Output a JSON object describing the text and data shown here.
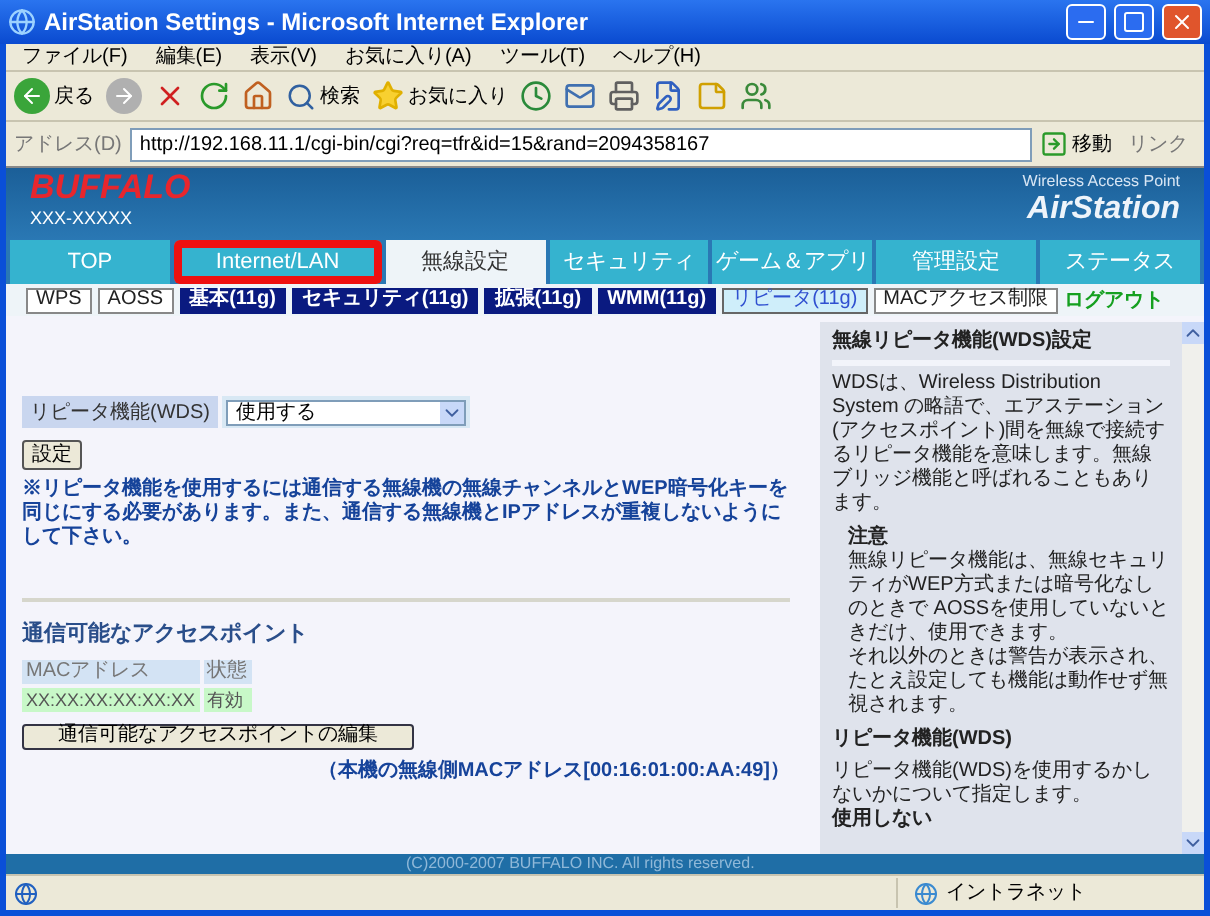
{
  "window": {
    "title": "AirStation Settings - Microsoft Internet Explorer"
  },
  "menu": [
    "ファイル(F)",
    "編集(E)",
    "表示(V)",
    "お気に入り(A)",
    "ツール(T)",
    "ヘルプ(H)"
  ],
  "toolbar": {
    "back": "戻る",
    "search": "検索",
    "favorites": "お気に入り"
  },
  "address_bar": {
    "label": "アドレス(D)",
    "url": "http://192.168.11.1/cgi-bin/cgi?req=tfr&id=15&rand=2094358167",
    "go": "移動",
    "links": "リンク"
  },
  "header": {
    "logo": "BUFFALO",
    "model": "XXX-XXXXX",
    "subtitle": "Wireless Access Point",
    "product": "AirStation"
  },
  "tabs": [
    {
      "label": "TOP",
      "selected": false,
      "highlighted": false
    },
    {
      "label": "Internet/LAN",
      "selected": false,
      "highlighted": true
    },
    {
      "label": "無線設定",
      "selected": true,
      "highlighted": false
    },
    {
      "label": "セキュリティ",
      "selected": false,
      "highlighted": false
    },
    {
      "label": "ゲーム＆アプリ",
      "selected": false,
      "highlighted": false
    },
    {
      "label": "管理設定",
      "selected": false,
      "highlighted": false
    },
    {
      "label": "ステータス",
      "selected": false,
      "highlighted": false
    }
  ],
  "subtabs": [
    {
      "label": "WPS",
      "kind": "plain",
      "selected": false
    },
    {
      "label": "AOSS",
      "kind": "plain",
      "selected": false
    },
    {
      "label": "基本(11g)",
      "kind": "dark",
      "selected": false
    },
    {
      "label": "セキュリティ(11g)",
      "kind": "dark",
      "selected": false
    },
    {
      "label": "拡張(11g)",
      "kind": "dark",
      "selected": false
    },
    {
      "label": "WMM(11g)",
      "kind": "dark",
      "selected": false
    },
    {
      "label": "リピータ(11g)",
      "kind": "plain",
      "selected": true
    },
    {
      "label": "MACアクセス制限",
      "kind": "plain",
      "selected": false
    }
  ],
  "logout": "ログアウト",
  "form": {
    "label": "リピータ機能(WDS)",
    "value": "使用する",
    "submit": "設定"
  },
  "note": "※リピータ機能を使用するには通信する無線機の無線チャンネルとWEP暗号化キーを同じにする必要があります。また、通信する無線機とIPアドレスが重複しないようにして下さい。",
  "access_points": {
    "title": "通信可能なアクセスポイント",
    "columns": [
      "MACアドレス",
      "状態"
    ],
    "rows": [
      [
        "XX:XX:XX:XX:XX:XX",
        "有効"
      ]
    ],
    "edit_button": "通信可能なアクセスポイントの編集"
  },
  "own_mac": "（本機の無線側MACアドレス[00:16:01:00:AA:49]）",
  "help": {
    "title": "無線リピータ機能(WDS)設定",
    "blocks": [
      {
        "kind": "text",
        "text": "WDSは、Wireless Distribution System の略語で、エアステーション(アクセスポイント)間を無線で接続するリピータ機能を意味します。無線ブリッジ機能と呼ばれることもあります。"
      },
      {
        "kind": "subheading",
        "text": "注意"
      },
      {
        "kind": "indented",
        "text": "無線リピータ機能は、無線セキュリティがWEP方式または暗号化なしのときで AOSSを使用していないときだけ、使用できます。"
      },
      {
        "kind": "indented",
        "text": "それ以外のときは警告が表示され、たとえ設定しても機能は動作せず無視されます。"
      },
      {
        "kind": "heading",
        "text": "リピータ機能(WDS)"
      },
      {
        "kind": "text",
        "text": "リピータ機能(WDS)を使用するかしないかについて指定します。"
      },
      {
        "kind": "bold",
        "text": "使用しない"
      }
    ]
  },
  "footer": "(C)2000-2007 BUFFALO INC. All rights reserved.",
  "status_bar": {
    "zone": "イントラネット"
  }
}
